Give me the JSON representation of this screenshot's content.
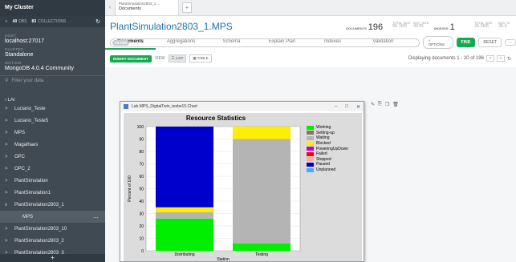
{
  "sidebar": {
    "title": "My Cluster",
    "dbs_count": "40",
    "dbs_label": "DBS",
    "collections_count": "83",
    "collections_label": "COLLECTIONS",
    "host_label": "HOST",
    "host": "localhost:27017",
    "cluster_label": "CLUSTER",
    "cluster": "Standalone",
    "edition_label": "EDITION",
    "edition": "MongoDB 4.0.4 Community",
    "filter_placeholder": "Filter your data",
    "partial_item": "LAI",
    "items": [
      {
        "label": "Luciano_Teste",
        "chevron": ">"
      },
      {
        "label": "Luciano_Teste5",
        "chevron": ">"
      },
      {
        "label": "MPS",
        "chevron": ">"
      },
      {
        "label": "Magalhaes",
        "chevron": ">"
      },
      {
        "label": "OPC",
        "chevron": ">"
      },
      {
        "label": "OPC_2",
        "chevron": ">"
      },
      {
        "label": "PlantSimulation",
        "chevron": ">"
      },
      {
        "label": "PlantSimulation1",
        "chevron": ">"
      },
      {
        "label": "PlantSimulation2803_1",
        "chevron": "v"
      },
      {
        "label": "MPS",
        "chevron": ""
      },
      {
        "label": "PlantSimulation2803_10",
        "chevron": ">"
      },
      {
        "label": "PlantSimulation2803_2",
        "chevron": ">"
      },
      {
        "label": "PlantSimulation2803_3",
        "chevron": ">"
      }
    ],
    "add_button": "+"
  },
  "tab": {
    "title": "PlantSimulation2803_1....",
    "subtitle": "Documents"
  },
  "collection": {
    "name": "PlantSimulation2803_1.MPS",
    "documents_label": "DOCUMENTS",
    "documents_count": "196",
    "total_size_label": "TOTAL SIZE",
    "total_size": "95.1KB",
    "avg_size_label": "AVG. SIZE",
    "avg_size": "497B",
    "indexes_label": "INDEXES",
    "indexes_count": "1",
    "idx_total_size_label": "TOTAL SIZE",
    "idx_total_size": "36.0KB",
    "idx_avg_size_label": "AVG. SI",
    "idx_avg_size": "36.0"
  },
  "subtabs": [
    "Documents",
    "Aggregations",
    "Schema",
    "Explain Plan",
    "Indexes",
    "Validation"
  ],
  "filterbar": {
    "pill": "FILTER",
    "options": "+ OPTIONS",
    "find": "FIND",
    "reset": "RESET",
    "more": "···"
  },
  "actionbar": {
    "insert": "INSERT DOCUMENT",
    "view_label": "VIEW",
    "list": "LIST",
    "table": "TABLE",
    "displaying": "Displaying documents 1 - 20 of 196"
  },
  "chart_window": {
    "title": "Lab.MPS_DigitalTwin_tesbe15.Chart",
    "min": "–",
    "max": "□",
    "close": "✕"
  },
  "chart_data": {
    "type": "bar",
    "title": "Resource Statistics",
    "xlabel": "Station",
    "ylabel": "Percent of 100",
    "ylim": [
      0,
      100
    ],
    "yticks": [
      0,
      10,
      20,
      30,
      40,
      50,
      60,
      70,
      80,
      90,
      100
    ],
    "categories": [
      "Distributing",
      "Testing"
    ],
    "series": [
      {
        "name": "Working",
        "color": "#00ee00",
        "values": [
          26,
          6
        ]
      },
      {
        "name": "Setting-up",
        "color": "#8a7560",
        "values": [
          0,
          0
        ]
      },
      {
        "name": "Waiting",
        "color": "#b4b4b4",
        "values": [
          5,
          84
        ]
      },
      {
        "name": "Blocked",
        "color": "#ffee00",
        "values": [
          4,
          10
        ]
      },
      {
        "name": "PoweringUpDown",
        "color": "#cc00cc",
        "values": [
          0,
          0
        ]
      },
      {
        "name": "Failed",
        "color": "#ff0000",
        "values": [
          0,
          0
        ]
      },
      {
        "name": "Stopped",
        "color": "#ffaaaa",
        "values": [
          0,
          0
        ]
      },
      {
        "name": "Paused",
        "color": "#0000cc",
        "values": [
          65,
          0
        ]
      },
      {
        "name": "Unplanned",
        "color": "#4da6ff",
        "values": [
          0,
          0
        ]
      }
    ]
  }
}
